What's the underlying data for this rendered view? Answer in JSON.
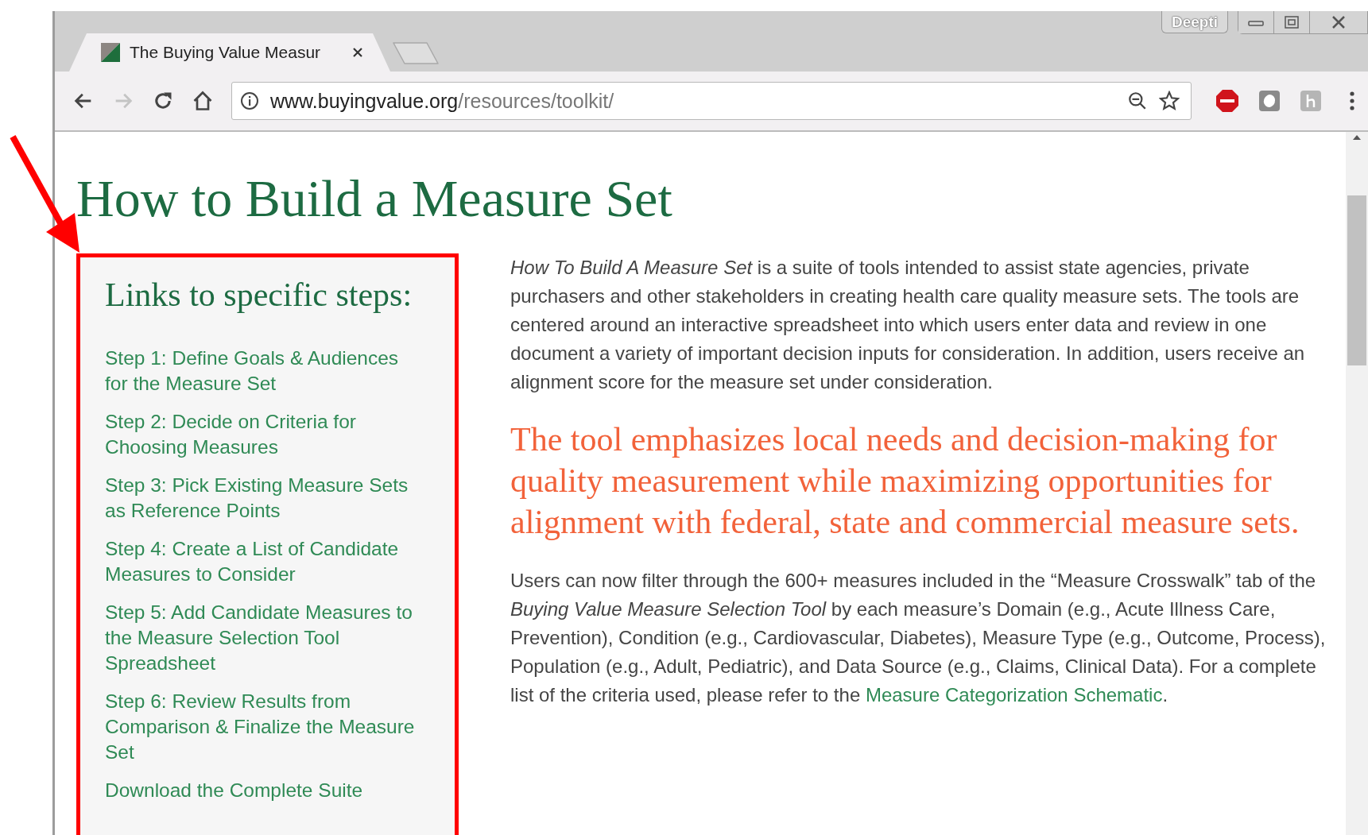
{
  "browser": {
    "tabs": [
      {
        "title": "The Buying Value Measur",
        "selected": true
      }
    ],
    "profile": "Deepti",
    "url_host": "www.buyingvalue.org",
    "url_path": "/resources/toolkit/"
  },
  "page": {
    "title": "How to Build a Measure Set",
    "sidebar": {
      "heading": "Links to specific steps:",
      "links": [
        {
          "label": "Step 1: Define Goals & Audiences for the Measure Set"
        },
        {
          "label": "Step 2: Decide on Criteria for Choosing Measures"
        },
        {
          "label": "Step 3: Pick Existing Measure Sets as Reference Points"
        },
        {
          "label": "Step 4: Create a List of Candidate Measures to Consider"
        },
        {
          "label": "Step 5: Add Candidate Measures to the Measure Selection Tool Spreadsheet"
        },
        {
          "label": "Step 6: Review Results from Comparison & Finalize the Measure Set"
        },
        {
          "label": "Download the Complete Suite"
        }
      ]
    },
    "intro": "*How To Build A Measure Set* is a suite of tools intended to assist state agencies, private purchasers and other stakeholders in creating health care quality measure sets. The tools are centered around an interactive spreadsheet into which users enter data and review in one document a variety of important decision inputs for consideration. In addition, users receive an alignment score for the measure set under consideration.",
    "callout": "The tool emphasizes local needs and decision-making for quality measurement while maximizing opportunities for alignment with federal, state and commercial measure sets.",
    "body": {
      "text": "Users can now filter through the 600+ measures included in the “Measure Crosswalk” tab of the *Buying Value Measure Selection Tool* by each measure’s Domain (e.g., Acute Illness Care, Prevention), Condition (e.g., Cardiovascular, Diabetes), Measure Type (e.g., Outcome, Process), Population (e.g., Adult, Pediatric), and Data Source (e.g., Claims, Clinical Data). For a complete list of the criteria used, please refer to the ",
      "link": "Measure Categorization Schematic",
      "after": "."
    }
  }
}
